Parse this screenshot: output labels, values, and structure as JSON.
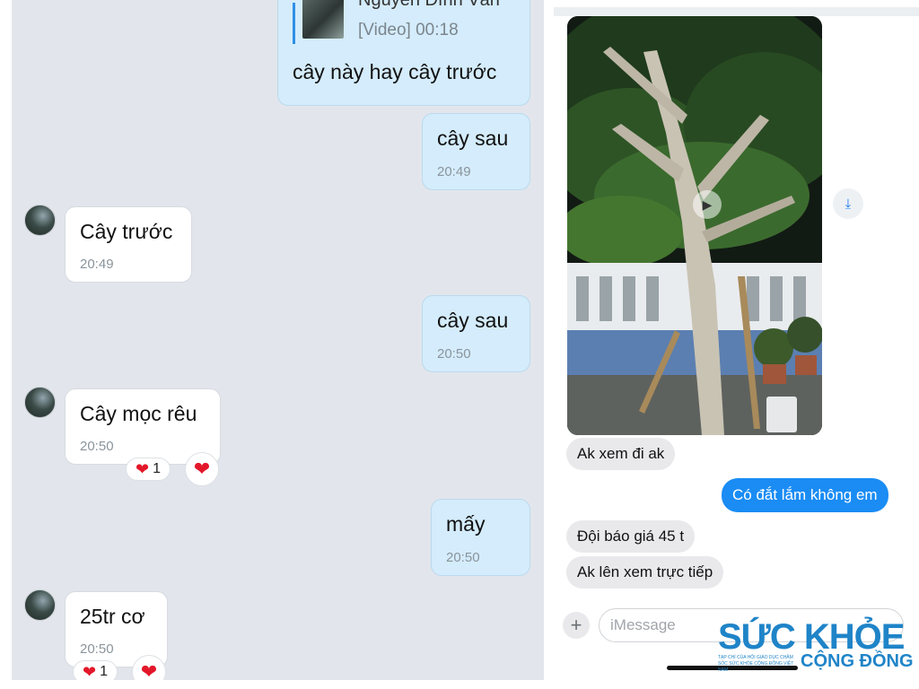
{
  "left_chat": {
    "quoted": {
      "sender": "Nguyễn Đình Văn",
      "label": "[Video] 00:18",
      "text": "cây này hay cây trước"
    },
    "messages": [
      {
        "text": "cây sau",
        "time": "20:49"
      },
      {
        "text": "Cây trước",
        "time": "20:49"
      },
      {
        "text": "cây sau",
        "time": "20:50"
      },
      {
        "text": "Cây mọc rêu",
        "time": "20:50",
        "reaction": {
          "emoji": "❤",
          "count": "1"
        }
      },
      {
        "text": "mấy",
        "time": "20:50"
      },
      {
        "text": "25tr cơ",
        "time": "20:50",
        "reaction": {
          "emoji": "❤",
          "count": "1"
        }
      }
    ]
  },
  "right_chat": {
    "messages": [
      {
        "text": "Ak xem đi ak"
      },
      {
        "text": "Có đắt lắm không em"
      },
      {
        "text": "Đội báo giá 45 t"
      },
      {
        "text": "Ak lên xem trực tiếp"
      }
    ],
    "input_placeholder": "iMessage",
    "plus_label": "+"
  },
  "icons": {
    "play": "play-icon",
    "save": "save-to-device-icon",
    "heart": "heart-icon"
  },
  "colors": {
    "zalo_outgoing": "#d4ecfb",
    "imessage_blue": "#1a8cf4",
    "heart_red": "#e3172a"
  },
  "watermark": {
    "main": "SỨC KHỎE",
    "sub": "CỘNG ĐỒNG",
    "tagline": "TẠP CHÍ CỦA HỘI GIÁO DỤC CHĂM SÓC SỨC KHỎE CỘNG ĐỒNG VIỆT NAM"
  }
}
